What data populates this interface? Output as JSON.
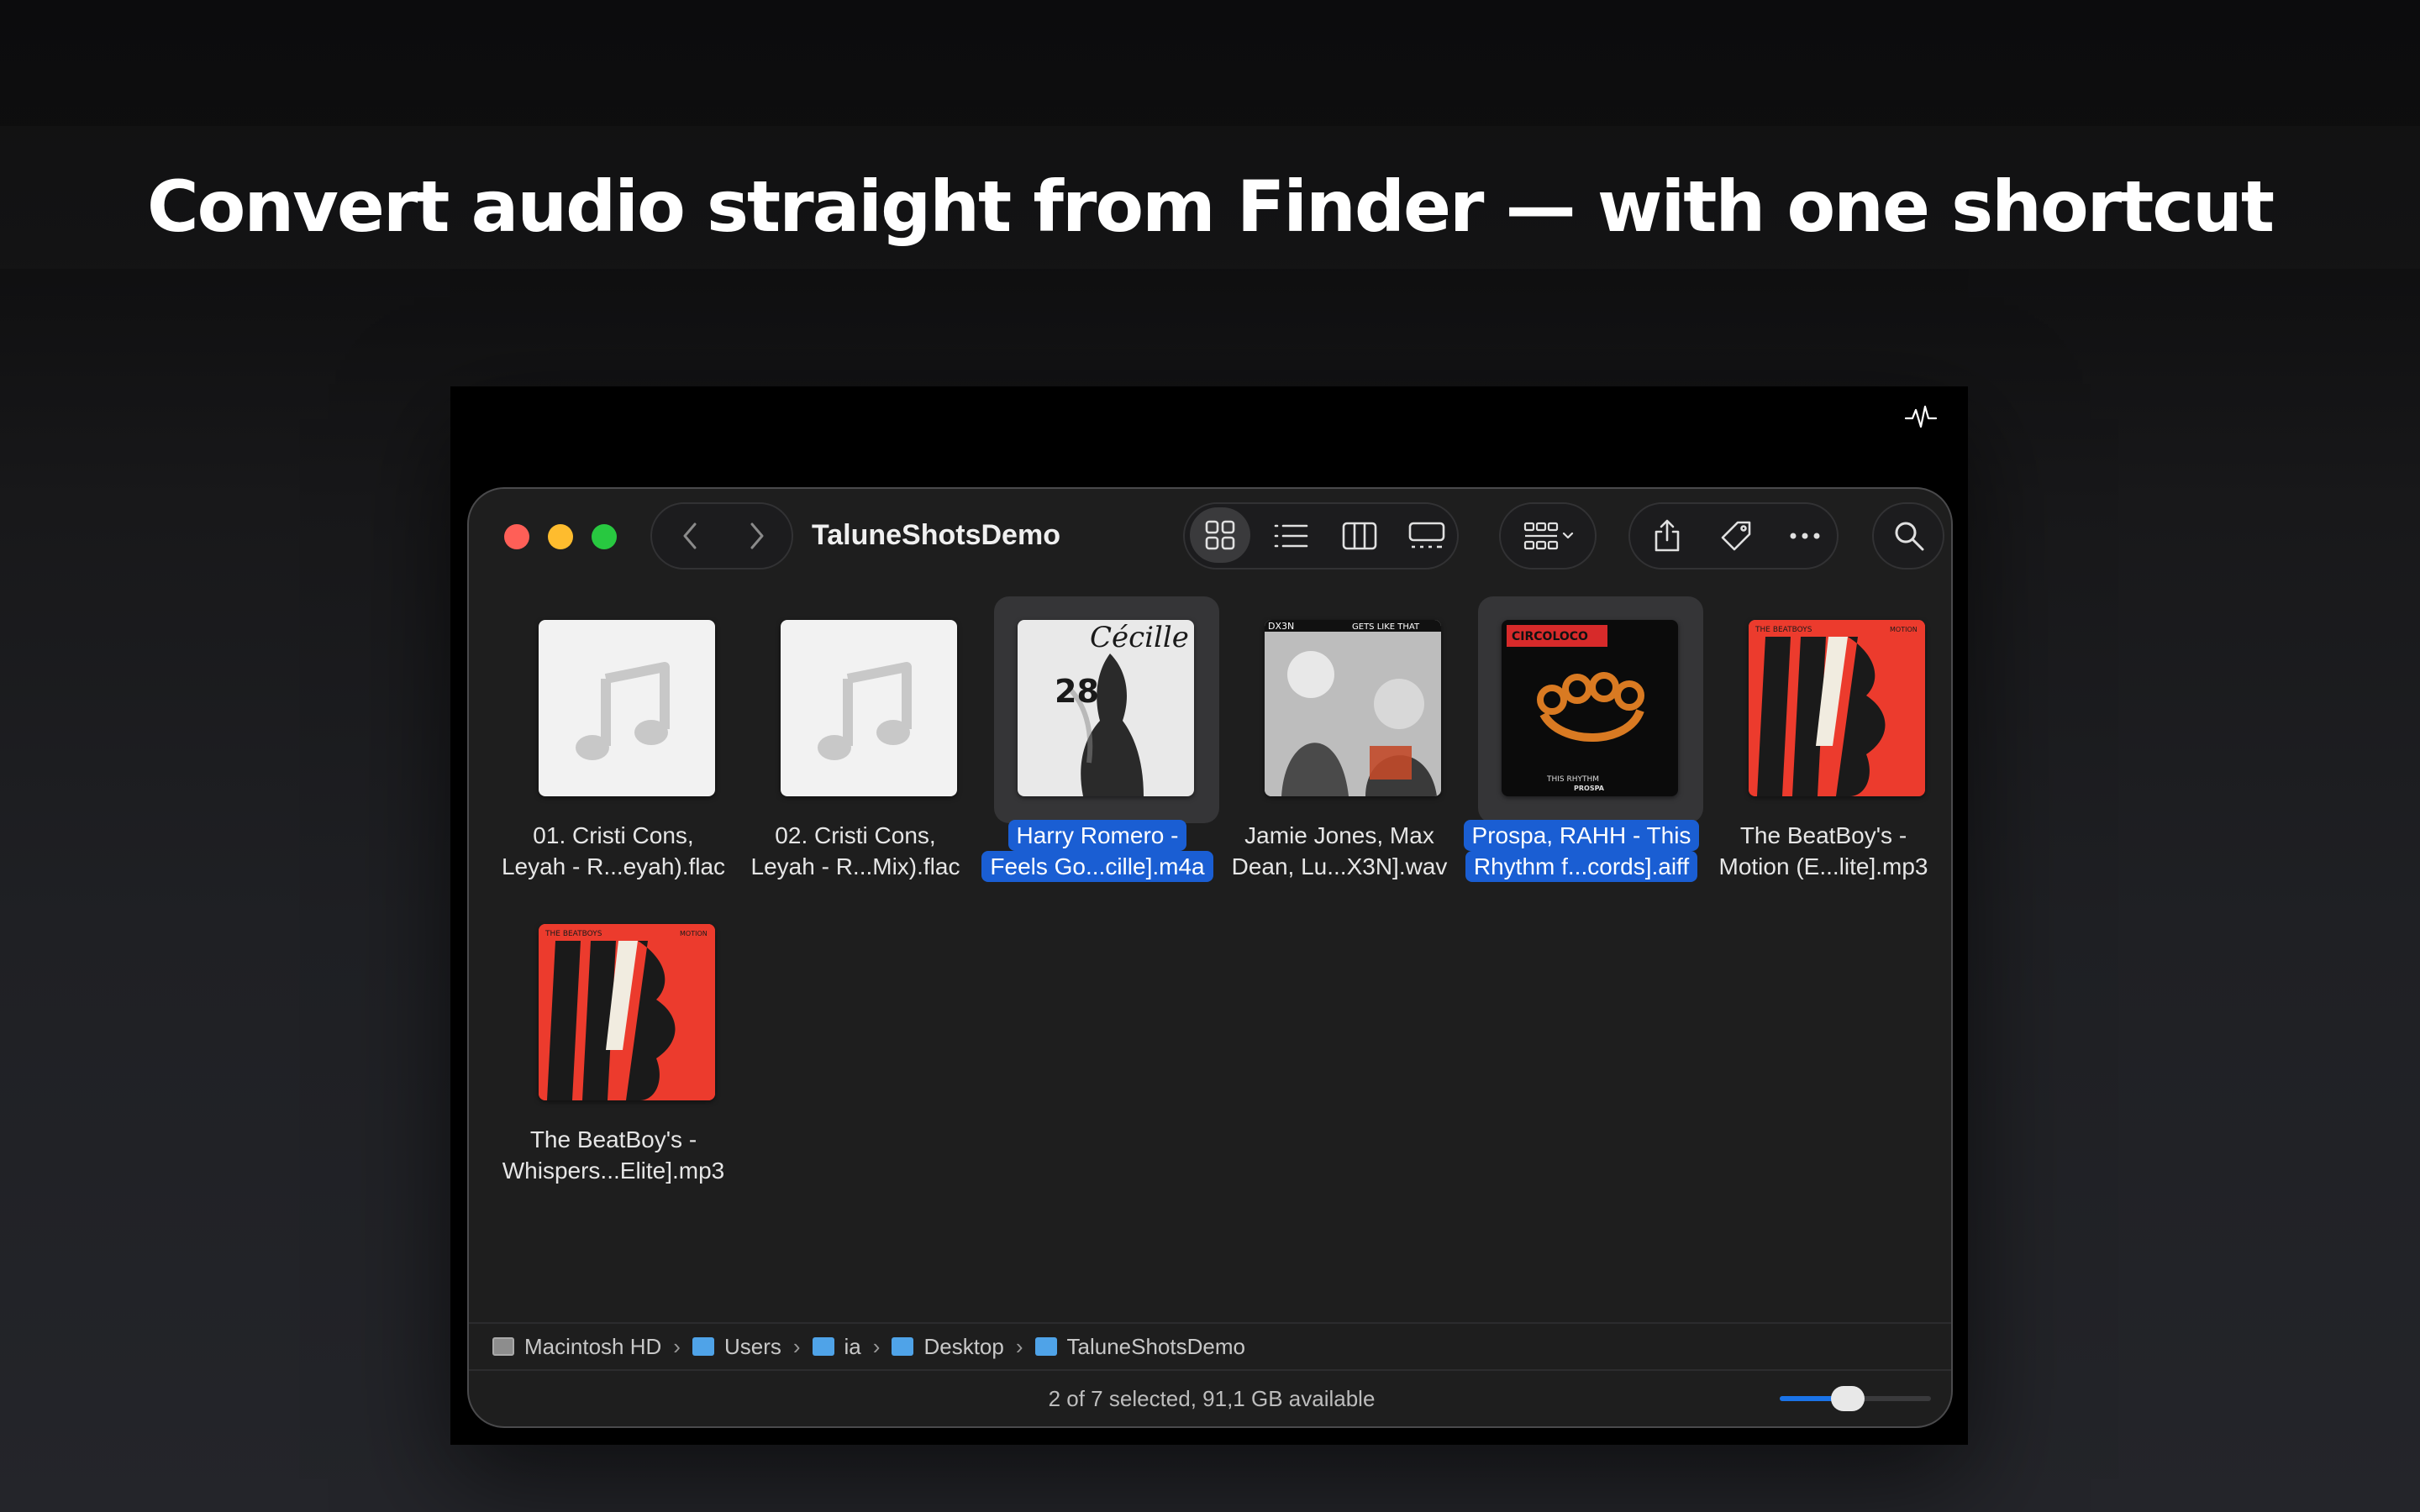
{
  "headline": "Convert audio straight from Finder — with one shortcut",
  "window": {
    "title": "TaluneShotsDemo"
  },
  "files": [
    {
      "name_line1": "01. Cristi Cons,",
      "name_line2": "Leyah - R...eyah).flac",
      "selected": false,
      "art": "music-placeholder"
    },
    {
      "name_line1": "02. Cristi Cons,",
      "name_line2": "Leyah - R...Mix).flac",
      "selected": false,
      "art": "music-placeholder"
    },
    {
      "name_line1": "Harry Romero -",
      "name_line2": "Feels Go...cille].m4a",
      "selected": true,
      "art": "cecille-28",
      "art_text1": "Cécille",
      "art_text2": "28"
    },
    {
      "name_line1": "Jamie Jones, Max",
      "name_line2": "Dean, Lu...X3N].wav",
      "selected": false,
      "art": "gets-like-that",
      "art_text1": "DX3N",
      "art_text2": "GETS LIKE THAT"
    },
    {
      "name_line1": "Prospa, RAHH - This",
      "name_line2": "Rhythm f...cords].aiff",
      "selected": true,
      "art": "circoloco",
      "art_text1": "CIRCOLOCO",
      "art_text2": "THIS RHYTHM",
      "art_text3": "PROSPA"
    },
    {
      "name_line1": "The BeatBoy's -",
      "name_line2": "Motion (E...lite].mp3",
      "selected": false,
      "art": "beatboys",
      "art_text1": "THE BEATBOYS",
      "art_text2": "MOTION"
    },
    {
      "name_line1": "The BeatBoy's -",
      "name_line2": "Whispers...Elite].mp3",
      "selected": false,
      "art": "beatboys",
      "art_text1": "THE BEATBOYS",
      "art_text2": "MOTION"
    }
  ],
  "path": [
    {
      "label": "Macintosh HD",
      "icon": "disk-icon"
    },
    {
      "label": "Users",
      "icon": "folder-users-icon"
    },
    {
      "label": "ia",
      "icon": "home-folder-icon"
    },
    {
      "label": "Desktop",
      "icon": "folder-icon"
    },
    {
      "label": "TaluneShotsDemo",
      "icon": "folder-icon"
    }
  ],
  "status": "2 of 7 selected, 91,1 GB available",
  "icon_size_slider": 0.45,
  "colors": {
    "selection": "#1a5ed3",
    "close": "#ff5f57",
    "minimize": "#febc2e",
    "zoom": "#28c840"
  }
}
